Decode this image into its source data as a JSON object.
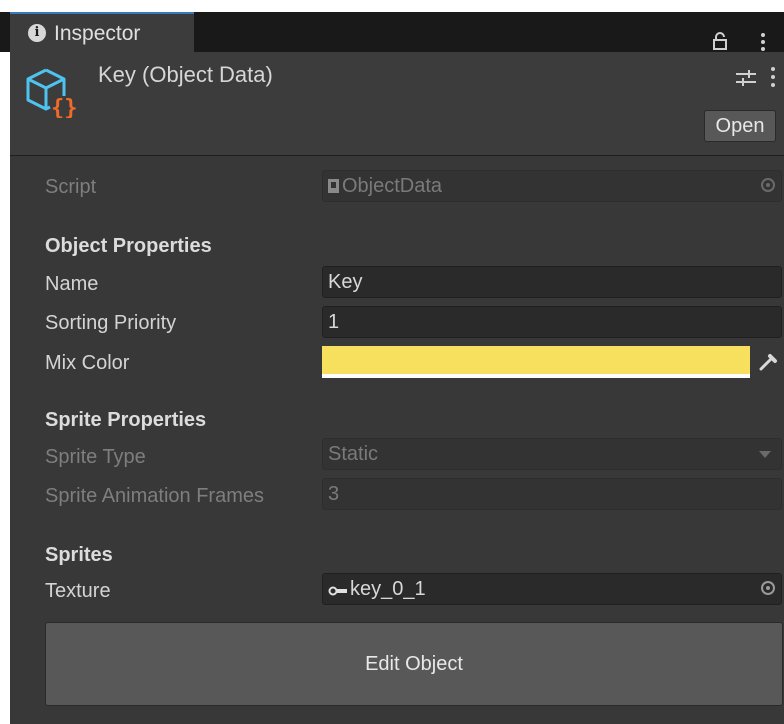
{
  "tab": {
    "title": "Inspector"
  },
  "header": {
    "title": "Key (Object Data)",
    "open_label": "Open"
  },
  "script": {
    "label": "Script",
    "value": "ObjectData"
  },
  "object_properties": {
    "heading": "Object Properties",
    "name_label": "Name",
    "name_value": "Key",
    "sorting_label": "Sorting Priority",
    "sorting_value": "1",
    "mix_color_label": "Mix Color",
    "mix_color_value": "#f6e05e"
  },
  "sprite_properties": {
    "heading": "Sprite Properties",
    "type_label": "Sprite Type",
    "type_value": "Static",
    "frames_label": "Sprite Animation Frames",
    "frames_value": "3"
  },
  "sprites": {
    "heading": "Sprites",
    "texture_label": "Texture",
    "texture_value": "key_0_1"
  },
  "edit_button_label": "Edit Object",
  "colors": {
    "accent": "#3a79bb",
    "asset_icon": "#4ec3f0",
    "script_braces": "#f06a2a"
  }
}
